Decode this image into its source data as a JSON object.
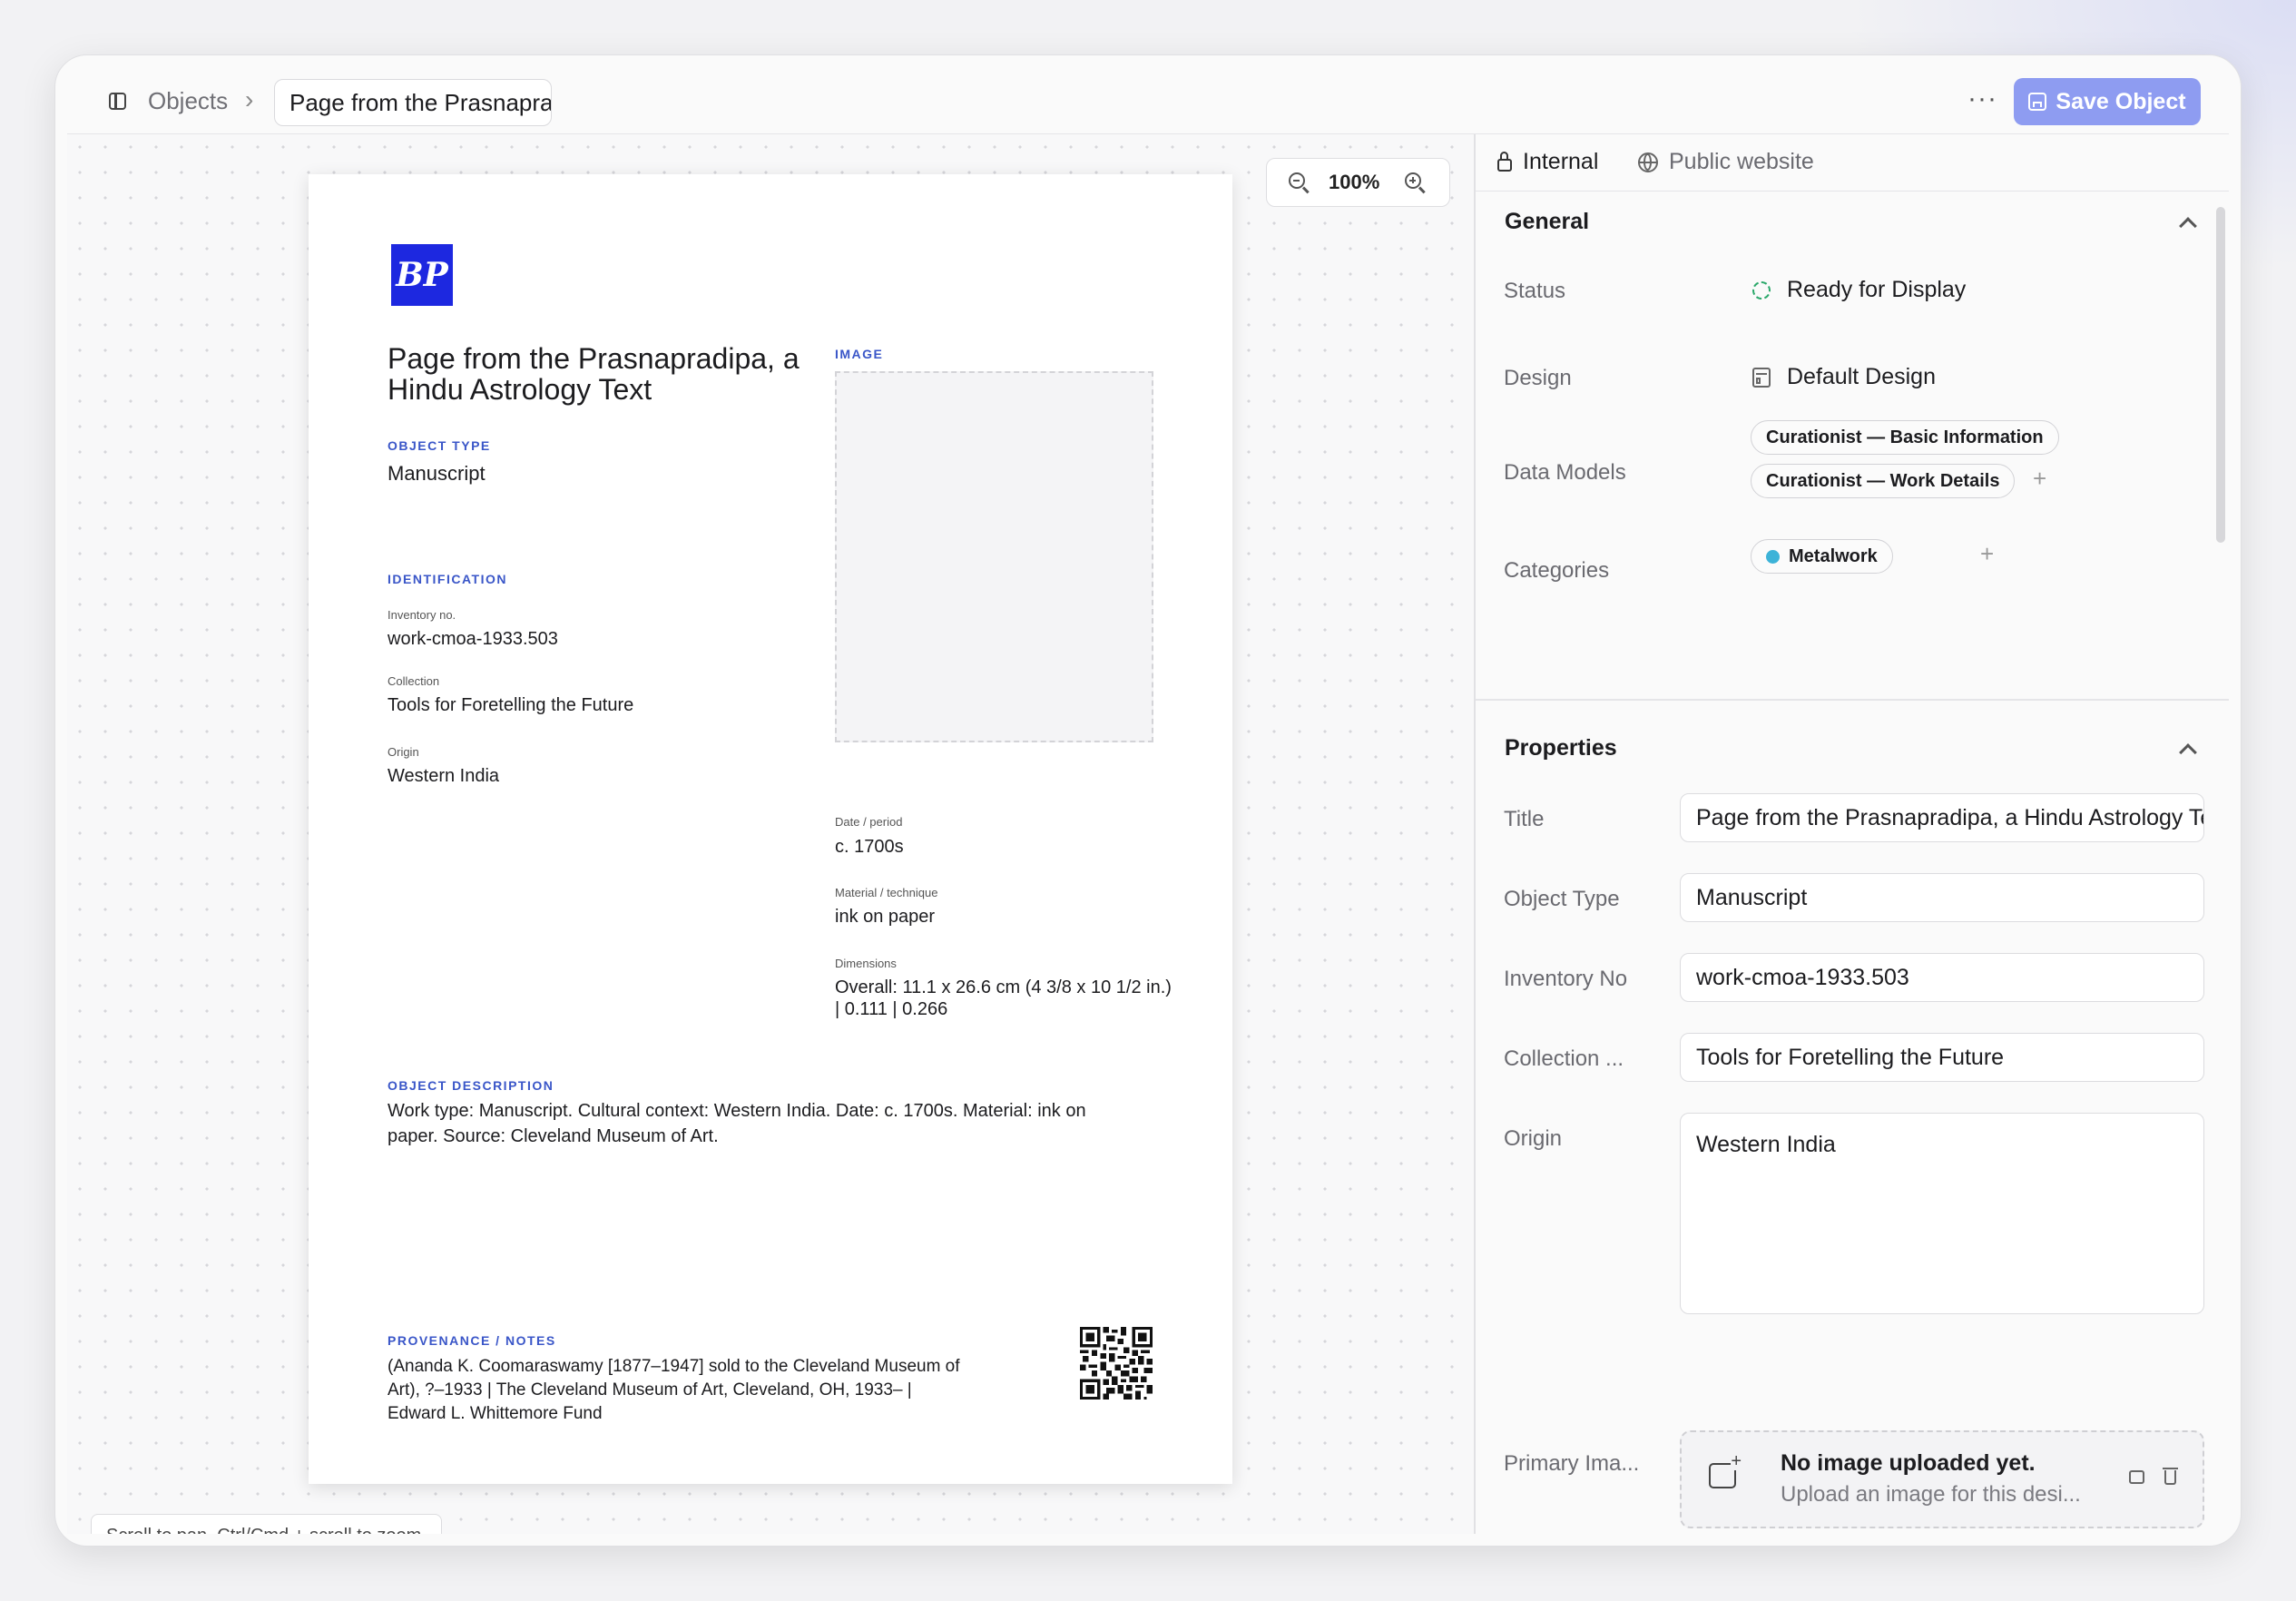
{
  "breadcrumb": {
    "root": "Objects",
    "current": "Page from the Prasnapradipa, a Hindu Astrology Text"
  },
  "toolbar": {
    "more_label": "···",
    "save_label": "Save Object",
    "accent": "#8e9cf1"
  },
  "canvas": {
    "zoom": "100%",
    "hint": "Scroll to pan. Ctrl/Cmd + scroll to zoom."
  },
  "page": {
    "logo_text": "BP",
    "title": "Page from the Prasnapradipa, a Hindu Astrology Text",
    "image_label": "IMAGE",
    "object_type_label": "OBJECT TYPE",
    "object_type": "Manuscript",
    "identification_label": "IDENTIFICATION",
    "inventory_label": "Inventory no.",
    "inventory": "work-cmoa-1933.503",
    "collection_label": "Collection",
    "collection": "Tools for Foretelling the Future",
    "origin_label": "Origin",
    "origin": "Western India",
    "date_label": "Date / period",
    "date": "c. 1700s",
    "material_label": "Material / technique",
    "material": "ink on paper",
    "dimensions_label": "Dimensions",
    "dimensions_line1": "Overall: 11.1 x 26.6 cm (4 3/8 x 10 1/2 in.)",
    "dimensions_line2": "| 0.111 | 0.266",
    "description_label": "OBJECT DESCRIPTION",
    "description": "Work type: Manuscript. Cultural context: Western India. Date: c. 1700s. Material: ink on paper. Source: Cleveland Museum of Art.",
    "provenance_label": "PROVENANCE / NOTES",
    "provenance": "(Ananda K. Coomaraswamy [1877–1947] sold to the Cleveland Museum of Art), ?–1933 | The Cleveland Museum of Art, Cleveland, OH, 1933– | Edward L. Whittemore Fund"
  },
  "panel": {
    "tabs": {
      "internal": "Internal",
      "public": "Public website"
    },
    "general": {
      "title": "General",
      "status_label": "Status",
      "status_value": "Ready for Display",
      "status_color": "#2ba86a",
      "design_label": "Design",
      "design_value": "Default Design",
      "data_models_label": "Data Models",
      "data_models": [
        "Curationist — Basic Information",
        "Curationist — Work Details"
      ],
      "categories_label": "Categories",
      "category": "Metalwork",
      "category_color": "#3db3d8",
      "add": "+"
    },
    "properties": {
      "title": "Properties",
      "title_label": "Title",
      "title_value": "Page from the Prasnapradipa, a Hindu Astrology Text",
      "object_type_label": "Object Type",
      "object_type_value": "Manuscript",
      "inventory_label": "Inventory No",
      "inventory_value": "work-cmoa-1933.503",
      "collection_label": "Collection ...",
      "collection_value": "Tools for Foretelling the Future",
      "origin_label": "Origin",
      "origin_value": "Western India",
      "primary_image_label": "Primary Ima...",
      "upload_title": "No image uploaded yet.",
      "upload_subtitle": "Upload an image for this desi..."
    }
  }
}
